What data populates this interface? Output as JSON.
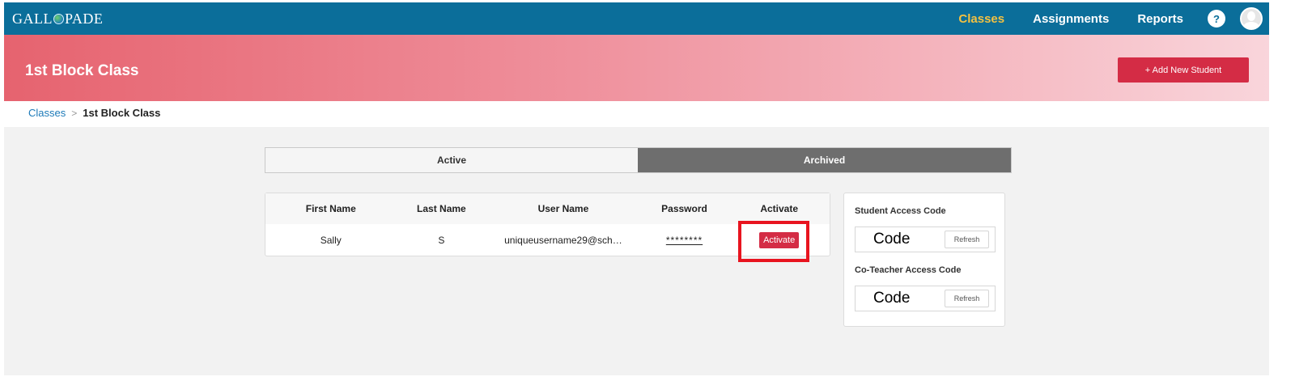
{
  "header": {
    "logo_text_left": "GALL",
    "logo_text_right": "PADE",
    "nav": [
      {
        "label": "Classes",
        "active": true
      },
      {
        "label": "Assignments",
        "active": false
      },
      {
        "label": "Reports",
        "active": false
      }
    ],
    "help_label": "?"
  },
  "hero": {
    "title": "1st Block Class",
    "add_button_label": "+ Add New Student"
  },
  "breadcrumb": {
    "link": "Classes",
    "separator": ">",
    "current": "1st Block Class"
  },
  "tabs": [
    {
      "label": "Active",
      "selected": false
    },
    {
      "label": "Archived",
      "selected": true
    }
  ],
  "students_table": {
    "columns": [
      "First Name",
      "Last Name",
      "User Name",
      "Password",
      "Activate"
    ],
    "rows": [
      {
        "first_name": "Sally",
        "last_name": "S",
        "user_name": "uniqueusername29@sch…",
        "password": "********",
        "action": "Activate"
      }
    ]
  },
  "access_codes": {
    "student_label": "Student Access Code",
    "student_code": "Code",
    "coteacher_label": "Co-Teacher Access Code",
    "coteacher_code": "Code",
    "refresh_label": "Refresh"
  },
  "colors": {
    "topbar": "#0b6e9a",
    "nav_active": "#f3c142",
    "accent_red": "#d42c45",
    "highlight": "#e8141f"
  }
}
